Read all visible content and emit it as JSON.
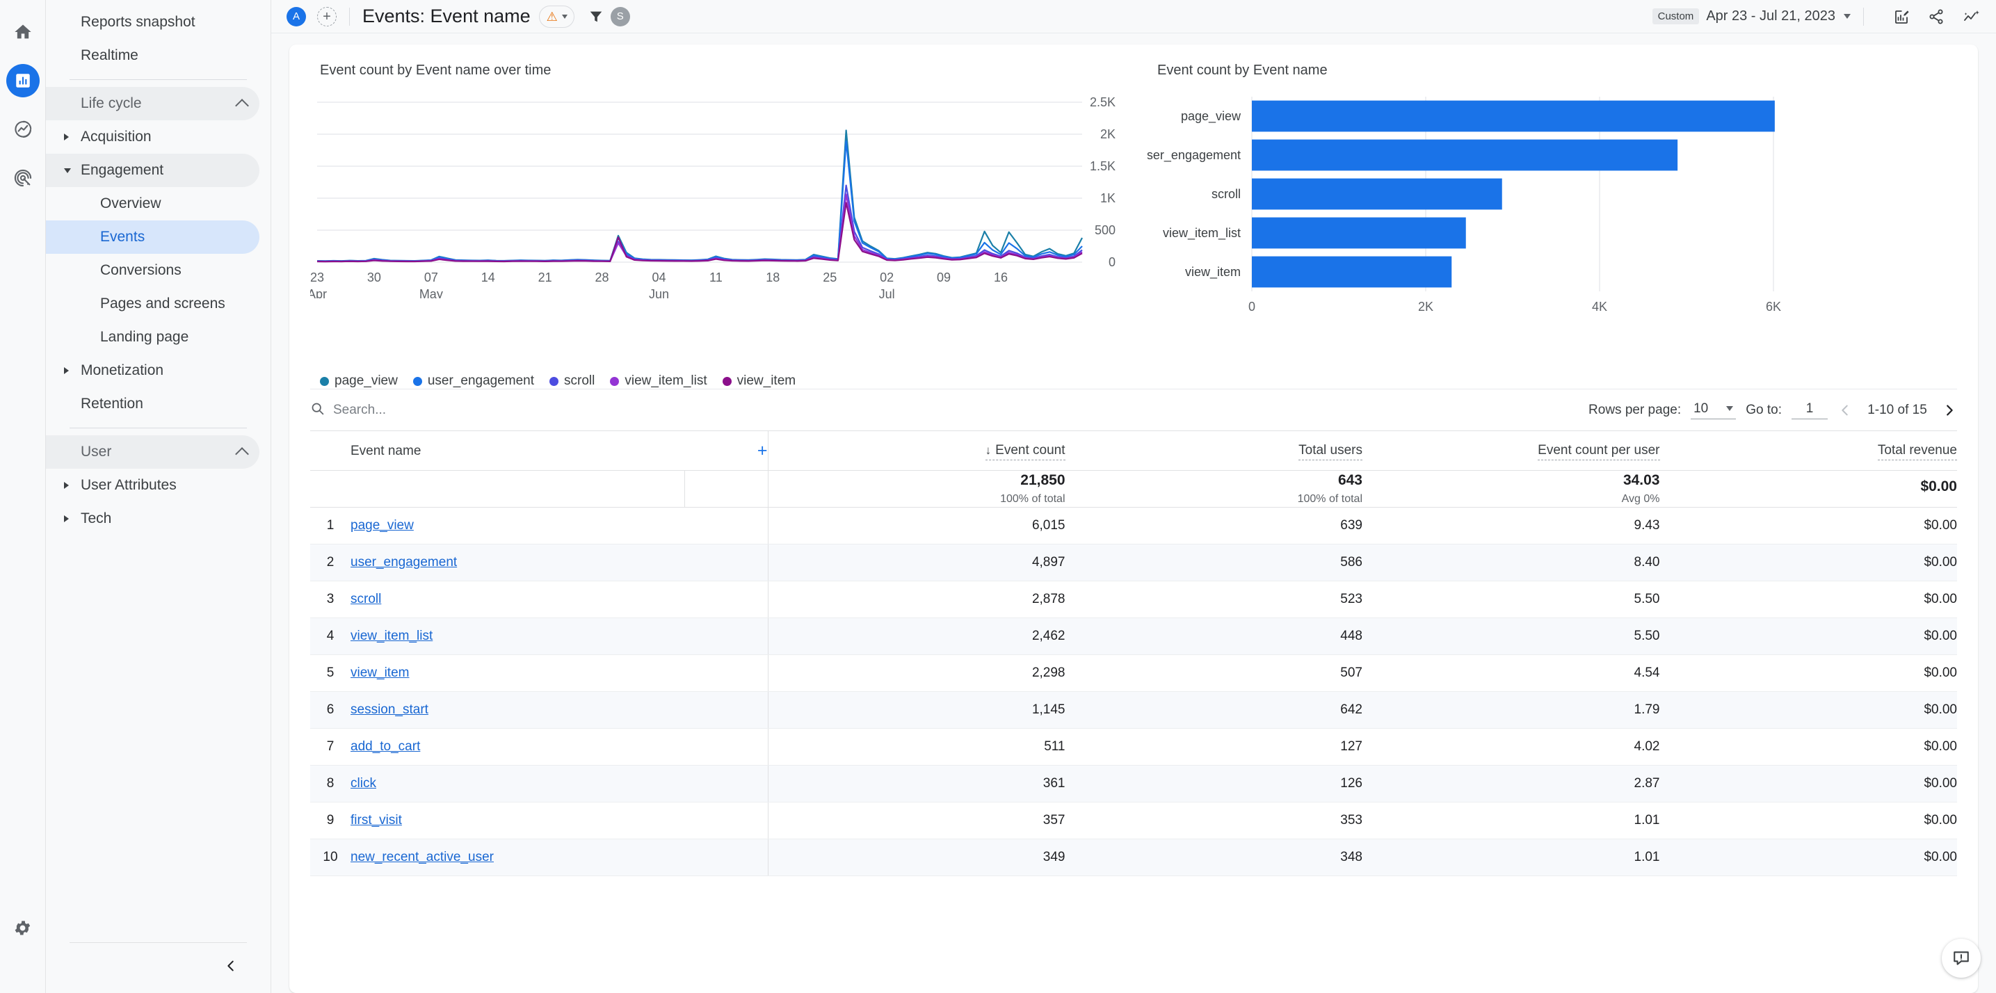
{
  "rail": {
    "items": [
      {
        "name": "home-icon",
        "label": "Home"
      },
      {
        "name": "reports-icon",
        "label": "Reports"
      },
      {
        "name": "explore-icon",
        "label": "Explore"
      },
      {
        "name": "advertising-icon",
        "label": "Advertising"
      }
    ],
    "gear_label": "Admin"
  },
  "nav": {
    "top_items": [
      {
        "label": "Reports snapshot"
      },
      {
        "label": "Realtime"
      }
    ],
    "sections": [
      {
        "label": "Life cycle",
        "items": [
          {
            "label": "Acquisition",
            "expandable": true,
            "expanded": false
          },
          {
            "label": "Engagement",
            "expandable": true,
            "expanded": true
          },
          {
            "label": "Overview",
            "child": true
          },
          {
            "label": "Events",
            "child": true,
            "selected": true
          },
          {
            "label": "Conversions",
            "child": true
          },
          {
            "label": "Pages and screens",
            "child": true
          },
          {
            "label": "Landing page",
            "child": true
          },
          {
            "label": "Monetization",
            "expandable": true,
            "expanded": false
          },
          {
            "label": "Retention"
          }
        ]
      },
      {
        "label": "User",
        "items": [
          {
            "label": "User Attributes",
            "expandable": true,
            "expanded": false
          },
          {
            "label": "Tech",
            "expandable": true,
            "expanded": false
          }
        ]
      }
    ],
    "collapse_label": "Collapse navigation"
  },
  "topbar": {
    "account_initial": "A",
    "add_comparison_label": "+",
    "title": "Events: Event name",
    "warning_icon": "warning-triangle-icon",
    "filter_icon": "filter-icon",
    "user_initial": "S",
    "date_badge": "Custom",
    "date_range": "Apr 23 - Jul 21, 2023",
    "icons": [
      {
        "name": "edit-report-icon",
        "label": "Edit"
      },
      {
        "name": "share-icon",
        "label": "Share this report"
      },
      {
        "name": "insights-icon",
        "label": "Insights"
      }
    ]
  },
  "line_chart": {
    "title": "Event count by Event name over time"
  },
  "bar_chart": {
    "title": "Event count by Event name"
  },
  "legend": [
    {
      "label": "page_view",
      "color": "#1a7fa8"
    },
    {
      "label": "user_engagement",
      "color": "#1a73e8"
    },
    {
      "label": "scroll",
      "color": "#4c4ce0"
    },
    {
      "label": "view_item_list",
      "color": "#9334d4"
    },
    {
      "label": "view_item",
      "color": "#8b0f8b"
    }
  ],
  "toolbar": {
    "search_placeholder": "Search...",
    "search_value": "",
    "search_icon": "search-icon",
    "rows_per_page_label": "Rows per page:",
    "rows_per_page_value": "10",
    "goto_label": "Go to:",
    "goto_value": "1",
    "page_count": "1-10 of 15",
    "prev_icon": "chevron-left-icon",
    "next_icon": "chevron-right-icon"
  },
  "table": {
    "columns": [
      {
        "label": "Event name",
        "sorted": false
      },
      {
        "label": "Event count",
        "sorted": true
      },
      {
        "label": "Total users",
        "sorted": false
      },
      {
        "label": "Event count per user",
        "sorted": false
      },
      {
        "label": "Total revenue",
        "sorted": false
      }
    ],
    "add_dimension_label": "+",
    "sort_indicator": "↓",
    "totals": {
      "event_count": "21,850",
      "event_count_sub": "100% of total",
      "total_users": "643",
      "total_users_sub": "100% of total",
      "count_per_user": "34.03",
      "count_per_user_sub": "Avg 0%",
      "total_revenue": "$0.00",
      "total_revenue_sub": ""
    },
    "rows": [
      {
        "idx": "1",
        "name": "page_view",
        "event_count": "6,015",
        "total_users": "639",
        "per_user": "9.43",
        "revenue": "$0.00"
      },
      {
        "idx": "2",
        "name": "user_engagement",
        "event_count": "4,897",
        "total_users": "586",
        "per_user": "8.40",
        "revenue": "$0.00"
      },
      {
        "idx": "3",
        "name": "scroll",
        "event_count": "2,878",
        "total_users": "523",
        "per_user": "5.50",
        "revenue": "$0.00"
      },
      {
        "idx": "4",
        "name": "view_item_list",
        "event_count": "2,462",
        "total_users": "448",
        "per_user": "5.50",
        "revenue": "$0.00"
      },
      {
        "idx": "5",
        "name": "view_item",
        "event_count": "2,298",
        "total_users": "507",
        "per_user": "4.54",
        "revenue": "$0.00"
      },
      {
        "idx": "6",
        "name": "session_start",
        "event_count": "1,145",
        "total_users": "642",
        "per_user": "1.79",
        "revenue": "$0.00"
      },
      {
        "idx": "7",
        "name": "add_to_cart",
        "event_count": "511",
        "total_users": "127",
        "per_user": "4.02",
        "revenue": "$0.00"
      },
      {
        "idx": "8",
        "name": "click",
        "event_count": "361",
        "total_users": "126",
        "per_user": "2.87",
        "revenue": "$0.00"
      },
      {
        "idx": "9",
        "name": "first_visit",
        "event_count": "357",
        "total_users": "353",
        "per_user": "1.01",
        "revenue": "$0.00"
      },
      {
        "idx": "10",
        "name": "new_recent_active_user",
        "event_count": "349",
        "total_users": "348",
        "per_user": "1.01",
        "revenue": "$0.00"
      }
    ]
  },
  "feedback": {
    "icon": "feedback-icon",
    "label": "Send feedback"
  },
  "chart_data": [
    {
      "type": "line",
      "title": "Event count by Event name over time",
      "xlabel": "",
      "ylabel": "",
      "ylim": [
        0,
        2500
      ],
      "yticks": [
        0,
        500,
        1000,
        1500,
        2000,
        2500
      ],
      "ytick_labels": [
        "0",
        "500",
        "1K",
        "1.5K",
        "2K",
        "2.5K"
      ],
      "grid": true,
      "legend_position": "bottom",
      "xtick_labels": [
        {
          "day": "23",
          "month": "Apr"
        },
        {
          "day": "30",
          "month": ""
        },
        {
          "day": "07",
          "month": "May"
        },
        {
          "day": "14",
          "month": ""
        },
        {
          "day": "21",
          "month": ""
        },
        {
          "day": "28",
          "month": ""
        },
        {
          "day": "04",
          "month": "Jun"
        },
        {
          "day": "11",
          "month": ""
        },
        {
          "day": "18",
          "month": ""
        },
        {
          "day": "25",
          "month": ""
        },
        {
          "day": "02",
          "month": "Jul"
        },
        {
          "day": "09",
          "month": ""
        },
        {
          "day": "16",
          "month": ""
        }
      ],
      "series": [
        {
          "name": "page_view",
          "color": "#1a7fa8",
          "values": [
            20,
            18,
            22,
            19,
            25,
            21,
            24,
            55,
            38,
            26,
            24,
            22,
            20,
            26,
            32,
            88,
            60,
            34,
            30,
            28,
            26,
            30,
            24,
            22,
            26,
            30,
            28,
            26,
            24,
            30,
            28,
            34,
            40,
            36,
            30,
            26,
            24,
            415,
            150,
            62,
            46,
            40,
            38,
            36,
            34,
            32,
            30,
            36,
            44,
            92,
            58,
            40,
            36,
            34,
            40,
            48,
            44,
            38,
            36,
            34,
            40,
            118,
            92,
            64,
            50,
            2060,
            700,
            330,
            250,
            180,
            60,
            52,
            70,
            96,
            120,
            150,
            132,
            96,
            70,
            78,
            110,
            140,
            480,
            260,
            150,
            470,
            300,
            120,
            90,
            160,
            210,
            130,
            100,
            140,
            380
          ]
        },
        {
          "name": "user_engagement",
          "color": "#1a73e8",
          "values": [
            18,
            16,
            20,
            17,
            22,
            19,
            22,
            48,
            34,
            24,
            22,
            20,
            18,
            24,
            30,
            80,
            54,
            30,
            27,
            25,
            24,
            27,
            22,
            20,
            24,
            27,
            25,
            24,
            22,
            27,
            25,
            31,
            36,
            33,
            27,
            24,
            22,
            380,
            135,
            56,
            42,
            36,
            34,
            32,
            31,
            29,
            27,
            33,
            40,
            84,
            52,
            36,
            33,
            31,
            36,
            44,
            40,
            34,
            33,
            31,
            36,
            108,
            84,
            58,
            45,
            1890,
            640,
            300,
            228,
            165,
            55,
            47,
            64,
            88,
            110,
            137,
            120,
            88,
            64,
            71,
            100,
            128,
            305,
            190,
            120,
            300,
            210,
            100,
            78,
            128,
            160,
            110,
            88,
            120,
            250
          ]
        },
        {
          "name": "scroll",
          "color": "#4c4ce0",
          "values": [
            14,
            12,
            16,
            13,
            17,
            15,
            17,
            38,
            27,
            19,
            17,
            16,
            14,
            19,
            24,
            62,
            42,
            24,
            21,
            20,
            19,
            21,
            17,
            16,
            19,
            21,
            20,
            19,
            17,
            21,
            20,
            24,
            28,
            26,
            21,
            19,
            17,
            320,
            110,
            45,
            34,
            29,
            27,
            26,
            25,
            23,
            21,
            26,
            32,
            66,
            41,
            29,
            26,
            25,
            29,
            35,
            32,
            27,
            26,
            25,
            29,
            85,
            66,
            46,
            36,
            1200,
            480,
            230,
            175,
            126,
            43,
            37,
            50,
            69,
            86,
            107,
            94,
            69,
            50,
            56,
            78,
            100,
            190,
            132,
            92,
            180,
            140,
            76,
            60,
            94,
            118,
            84,
            68,
            92,
            190
          ]
        },
        {
          "name": "view_item_list",
          "color": "#9334d4",
          "values": [
            12,
            10,
            13,
            11,
            15,
            13,
            15,
            32,
            22,
            16,
            14,
            13,
            12,
            16,
            20,
            52,
            35,
            20,
            18,
            17,
            16,
            18,
            14,
            13,
            16,
            18,
            17,
            16,
            14,
            18,
            17,
            20,
            24,
            22,
            18,
            16,
            14,
            300,
            95,
            38,
            29,
            25,
            23,
            22,
            21,
            20,
            18,
            22,
            27,
            56,
            35,
            25,
            22,
            21,
            25,
            30,
            27,
            23,
            22,
            21,
            25,
            72,
            56,
            39,
            30,
            1060,
            410,
            196,
            149,
            108,
            37,
            32,
            43,
            59,
            73,
            91,
            80,
            59,
            43,
            48,
            66,
            85,
            160,
            112,
            78,
            150,
            118,
            65,
            51,
            80,
            100,
            72,
            58,
            78,
            160
          ]
        },
        {
          "name": "view_item",
          "color": "#8b0f8b",
          "values": [
            10,
            9,
            11,
            10,
            13,
            11,
            13,
            27,
            19,
            14,
            12,
            11,
            10,
            14,
            17,
            44,
            30,
            17,
            15,
            14,
            14,
            15,
            12,
            11,
            14,
            15,
            14,
            14,
            12,
            15,
            14,
            17,
            20,
            19,
            15,
            14,
            12,
            390,
            85,
            33,
            25,
            21,
            20,
            19,
            18,
            17,
            16,
            19,
            23,
            48,
            30,
            21,
            19,
            18,
            21,
            26,
            23,
            20,
            19,
            18,
            21,
            62,
            48,
            33,
            26,
            930,
            350,
            168,
            128,
            92,
            32,
            27,
            37,
            51,
            63,
            78,
            69,
            51,
            37,
            41,
            57,
            73,
            138,
            96,
            67,
            129,
            101,
            56,
            44,
            69,
            86,
            62,
            50,
            67,
            138
          ]
        }
      ]
    },
    {
      "type": "bar",
      "orientation": "horizontal",
      "title": "Event count by Event name",
      "categories": [
        "page_view",
        "user_engagement",
        "scroll",
        "view_item_list",
        "view_item"
      ],
      "values": [
        6015,
        4897,
        2878,
        2462,
        2298
      ],
      "bar_color": "#1a73e8",
      "xlim": [
        0,
        6000
      ],
      "xticks": [
        0,
        2000,
        4000,
        6000
      ],
      "xtick_labels": [
        "0",
        "2K",
        "4K",
        "6K"
      ],
      "xlabel": "",
      "ylabel": "",
      "grid": true
    }
  ]
}
